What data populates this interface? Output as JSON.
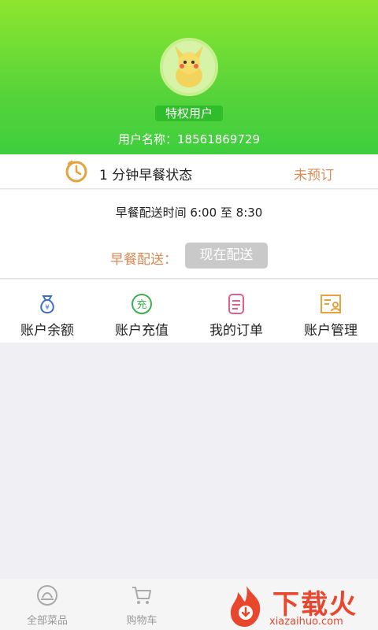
{
  "profile": {
    "badge": "特权用户",
    "username_label": "用户名称：",
    "username_value": "18561869729"
  },
  "status": {
    "title": "1 分钟早餐状态",
    "value": "未预订",
    "icon": "clock-icon"
  },
  "delivery": {
    "time_text": "早餐配送时间 6:00 至 8:30",
    "label": "早餐配送：",
    "button": "现在配送"
  },
  "menu": [
    {
      "label": "账户余额",
      "icon": "money-bag-icon",
      "color": "#3a6fc4"
    },
    {
      "label": "账户充值",
      "icon": "recharge-icon",
      "color": "#3ab34a"
    },
    {
      "label": "我的订单",
      "icon": "order-list-icon",
      "color": "#e0608a"
    },
    {
      "label": "账户管理",
      "icon": "account-card-icon",
      "color": "#e6a23c"
    }
  ],
  "tabs": [
    {
      "label": "全部菜品",
      "icon": "dish-icon"
    },
    {
      "label": "购物车",
      "icon": "cart-icon"
    }
  ],
  "watermark": {
    "text": "下载火",
    "sub": "xiazaihuo.com"
  },
  "colors": {
    "header_green": "#57d43a",
    "accent_orange": "#d98a55",
    "badge_green": "#2fbd2c"
  }
}
